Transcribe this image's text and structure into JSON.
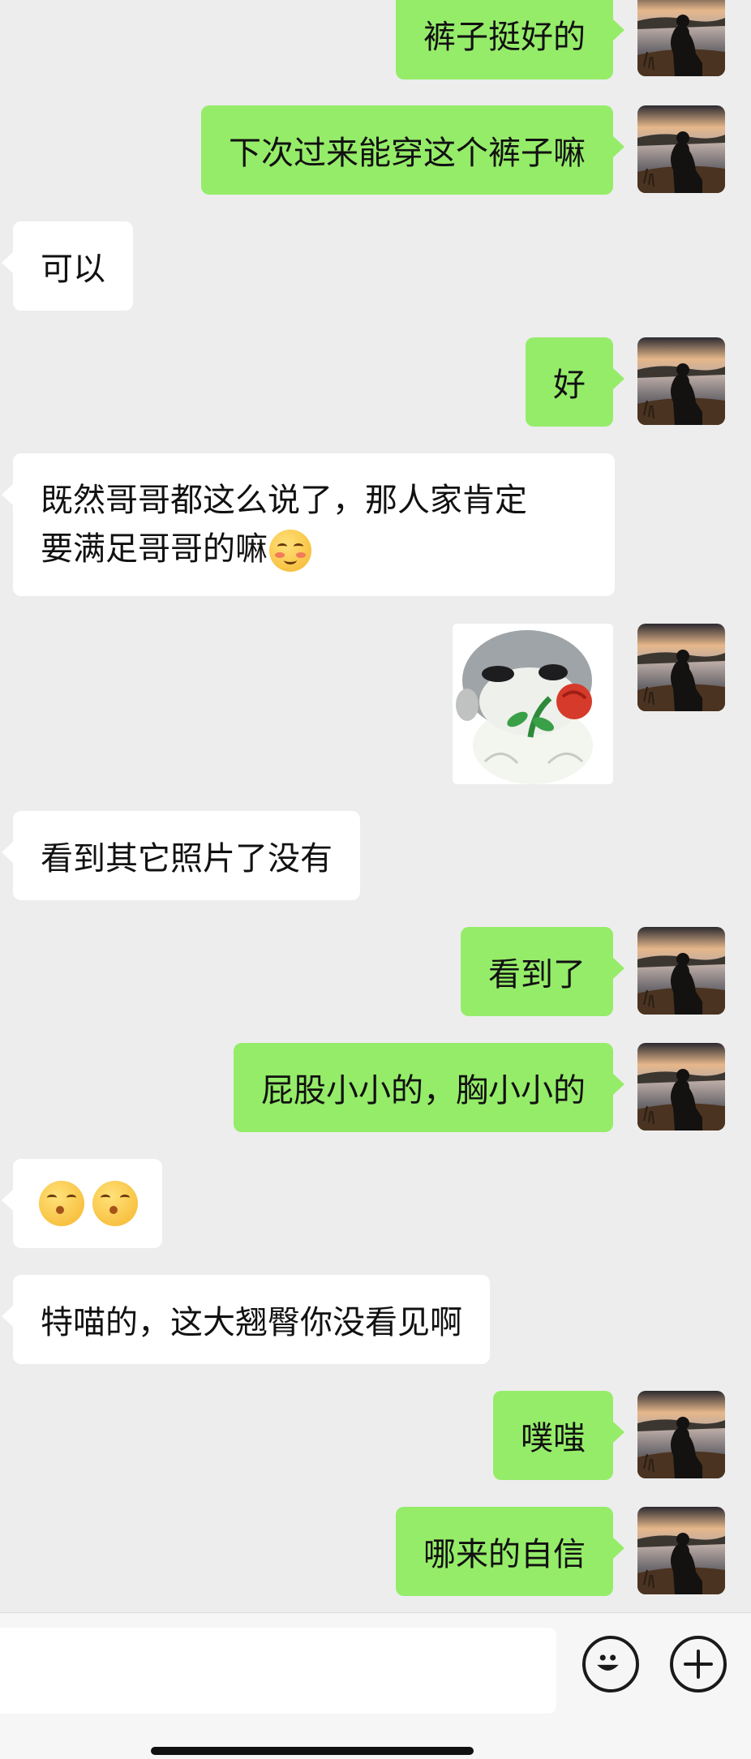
{
  "messages": [
    {
      "dir": "out",
      "text": "裤子挺好的"
    },
    {
      "dir": "out",
      "text": "下次过来能穿这个裤子嘛"
    },
    {
      "dir": "in",
      "text": "可以"
    },
    {
      "dir": "out",
      "text": "好"
    },
    {
      "dir": "in",
      "text_line1": "既然哥哥都这么说了，那人家肯定",
      "text_line2": "要满足哥哥的嘛",
      "emoji": "blushing-face-emoji"
    },
    {
      "dir": "out",
      "sticker": "hamster-holding-rose-sticker"
    },
    {
      "dir": "in",
      "text": "看到其它照片了没有"
    },
    {
      "dir": "out",
      "text": "看到了"
    },
    {
      "dir": "out",
      "text": "屁股小小的，胸小小的"
    },
    {
      "dir": "in",
      "emojis": [
        "kissing-face-emoji",
        "kissing-face-emoji"
      ]
    },
    {
      "dir": "in",
      "text": "特喵的，这大翘臀你没看见啊"
    },
    {
      "dir": "out",
      "text": "噗嗤"
    },
    {
      "dir": "out",
      "text": "哪来的自信"
    }
  ],
  "colors": {
    "background": "#ededed",
    "outgoing_bubble": "#95ec69",
    "incoming_bubble": "#ffffff"
  },
  "input_bar": {
    "emoji_button_icon": "smiley-icon",
    "plus_button_icon": "plus-icon"
  }
}
